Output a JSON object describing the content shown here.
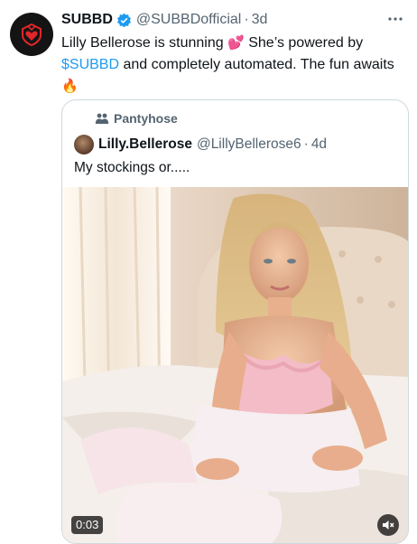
{
  "tweet": {
    "author_name": "SUBBD",
    "author_handle": "@SUBBDofficial",
    "separator": "·",
    "time": "3d",
    "text_part1": "Lilly Bellerose is stunning ",
    "emoji_hearts": "💕",
    "text_part2": " She’s powered by ",
    "cashtag": "$SUBBD",
    "text_part3": " and completely automated. The fun awaits ",
    "emoji_fire": "🔥"
  },
  "quote": {
    "community": "Pantyhose",
    "author_name": "Lilly.Bellerose",
    "author_handle": "@LillyBellerose6",
    "separator": "·",
    "time": "4d",
    "text": "My stockings or.....",
    "video": {
      "duration": "0:03",
      "muted": true
    }
  },
  "colors": {
    "link": "#1d9bf0",
    "secondary_text": "#536471",
    "brand_red": "#e0262a"
  },
  "icons": {
    "avatar": "subbd-logo-icon",
    "verified": "verified-badge-icon",
    "more": "more-icon",
    "community": "community-icon",
    "mute": "mute-icon"
  }
}
